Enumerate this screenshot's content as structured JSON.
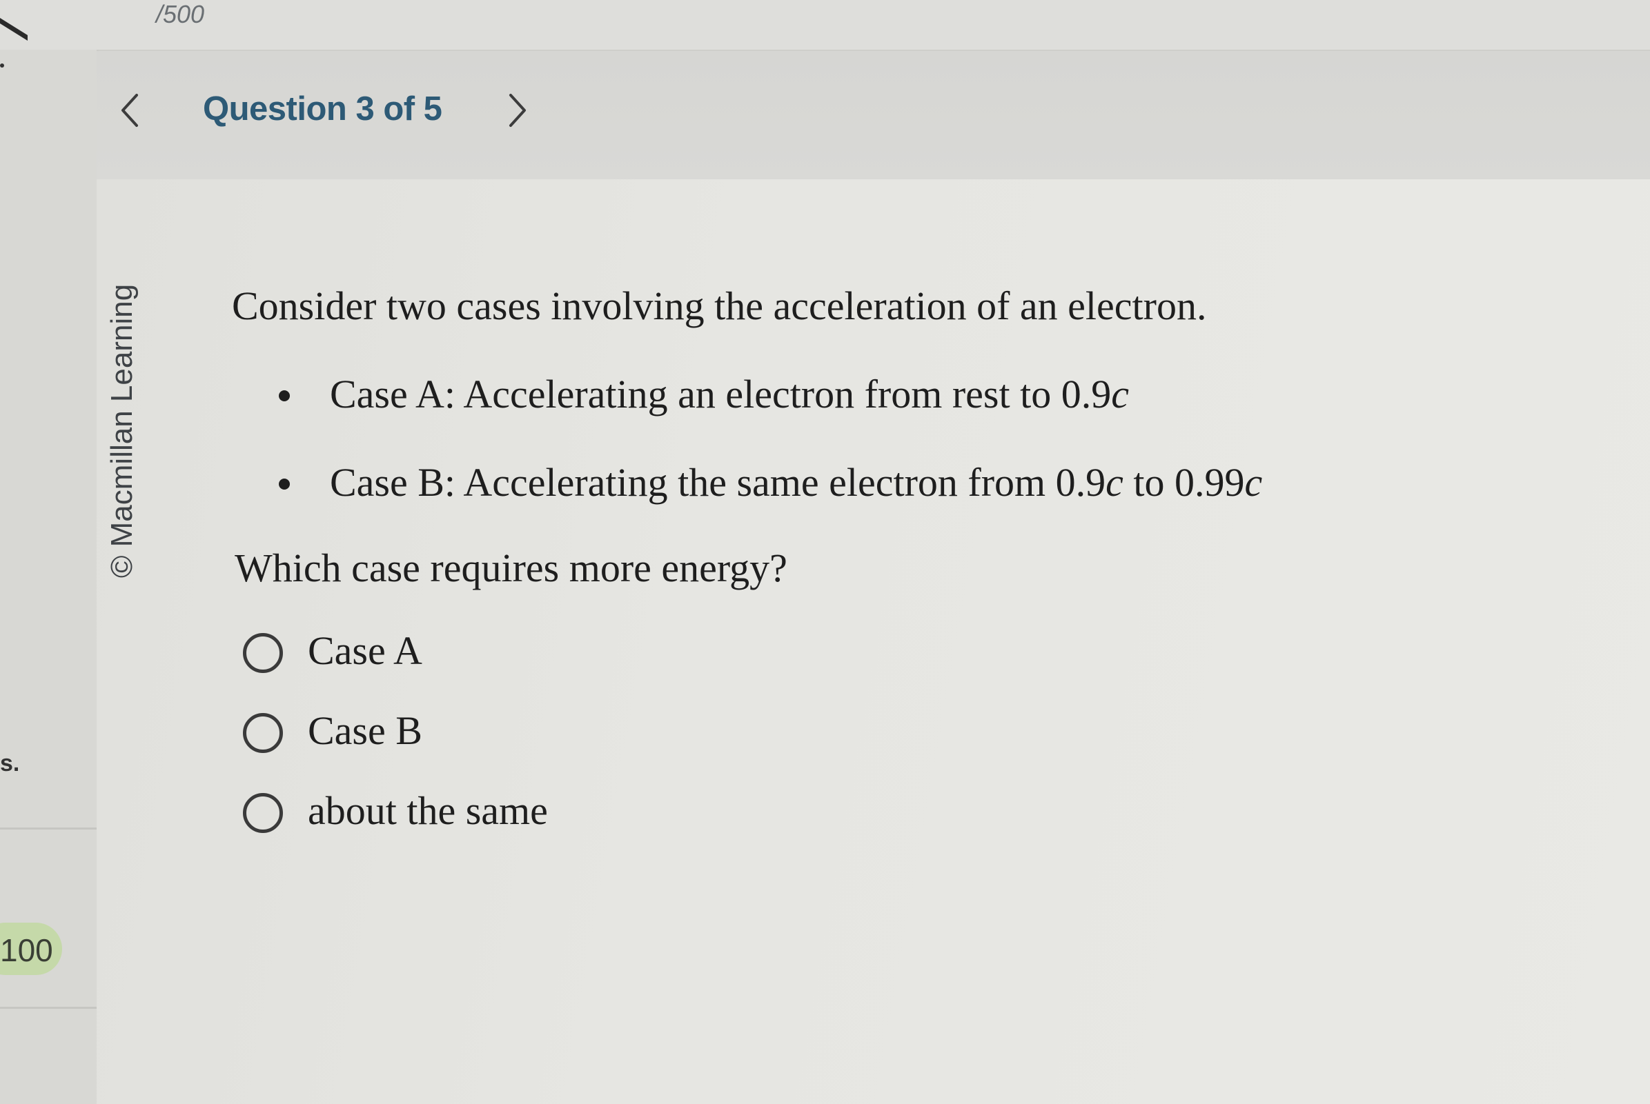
{
  "header": {
    "score_total": "/500"
  },
  "nav": {
    "title": "Question 3 of 5"
  },
  "sidebar": {
    "stub_text": "s.",
    "score": "100"
  },
  "content": {
    "copyright": "© Macmillan Learning",
    "intro": "Consider two cases involving the acceleration of an electron.",
    "case_a": {
      "prefix": "Case A: Accelerating an electron from rest to 0.9",
      "var": "c"
    },
    "case_b": {
      "prefix": "Case B: Accelerating the same electron from 0.9",
      "var1": "c",
      "mid": " to 0.99",
      "var2": "c"
    },
    "question": "Which case requires more energy?",
    "choices": [
      {
        "label": "Case A"
      },
      {
        "label": "Case B"
      },
      {
        "label": "about the same"
      }
    ]
  }
}
